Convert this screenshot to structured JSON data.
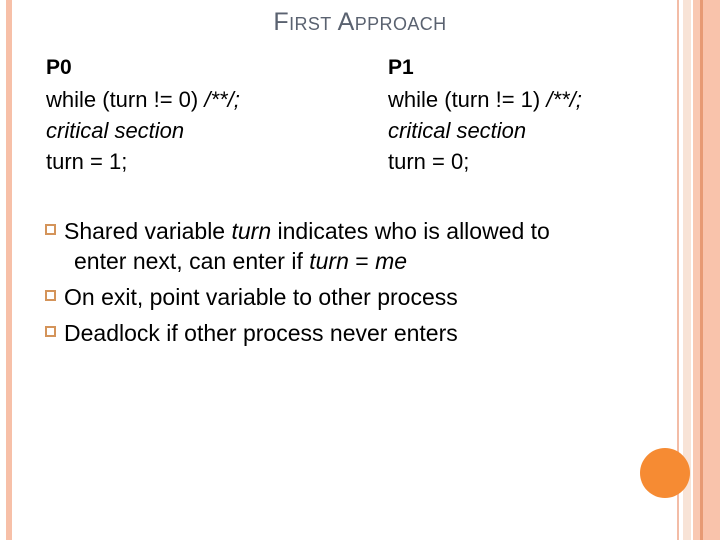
{
  "slide": {
    "title": "First Approach",
    "background_color": "#FFFFFF",
    "title_color": "#5A6270"
  },
  "decor": {
    "left_stripe_color": "#F7C0A8",
    "right_stripe_colors": [
      "#F3BCA6",
      "#F8E3D6",
      "#F9C8B2",
      "#E79A74",
      "#F9C3AB"
    ],
    "circle_color": "#F68B33"
  },
  "code": {
    "rows": [
      {
        "p0": {
          "text": "P0",
          "style": "bold"
        },
        "p1": {
          "text": "P1",
          "style": "bold"
        }
      },
      {
        "p0": {
          "text": "while (turn != 0) ",
          "tail": "/**/;",
          "style": "normal"
        },
        "p1": {
          "text": "while (turn != 1) ",
          "tail": "/**/;",
          "style": "normal"
        }
      },
      {
        "p0": {
          "text": "critical section",
          "style": "italic"
        },
        "p1": {
          "text": "critical section",
          "style": "italic"
        }
      },
      {
        "p0": {
          "text": "turn = 1;",
          "style": "normal"
        },
        "p1": {
          "text": "turn = 0;",
          "style": "normal"
        }
      }
    ]
  },
  "bullets": {
    "marker": "hollow-square",
    "marker_color": "#D4945A",
    "items": [
      {
        "line1_a": "Shared variable ",
        "line1_em": "turn",
        "line1_b": " indicates who is allowed to",
        "line2_a": "enter next, can enter if ",
        "line2_em1": "turn",
        "line2_mid": " = ",
        "line2_em2": "me"
      },
      {
        "line1_a": "On exit, point variable to other process"
      },
      {
        "line1_a": "Deadlock if other process never enters"
      }
    ]
  }
}
